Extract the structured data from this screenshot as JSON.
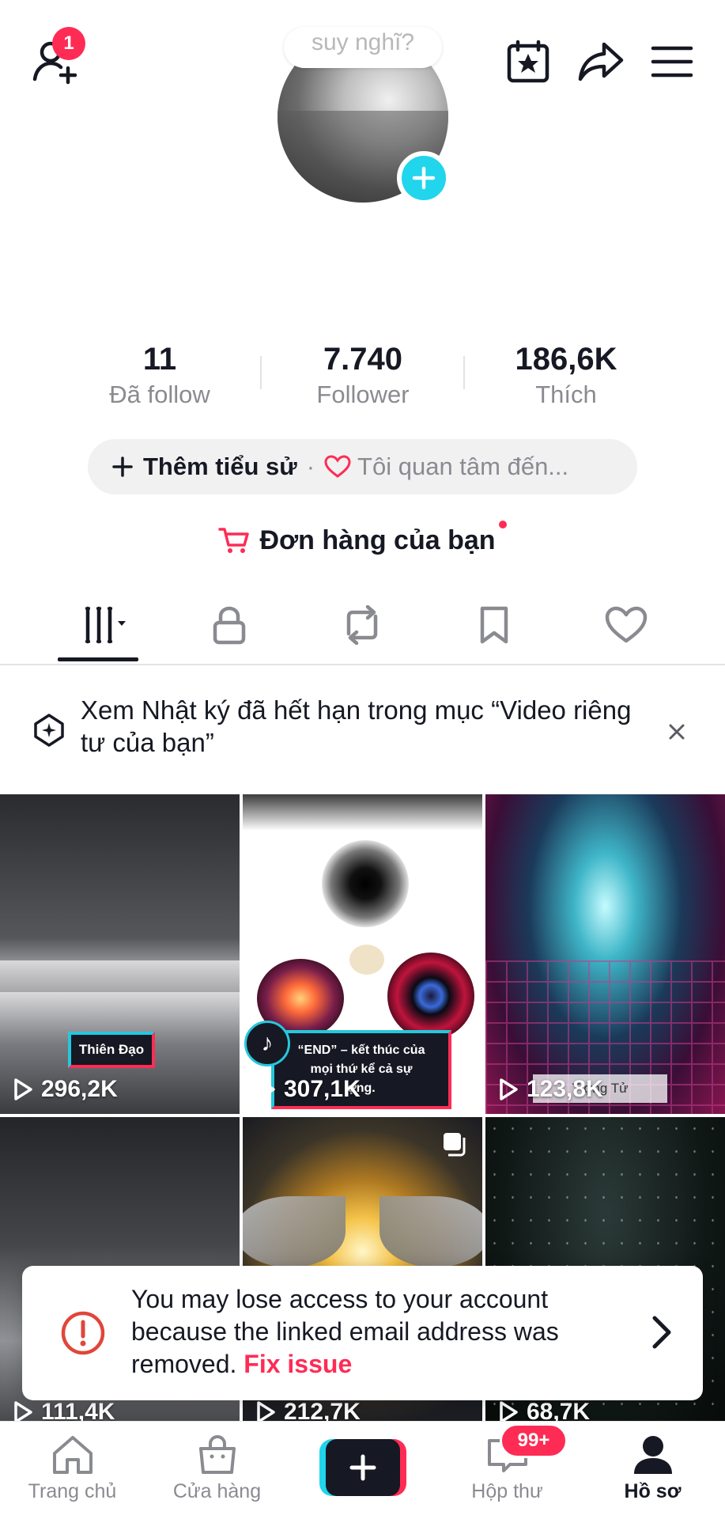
{
  "header": {
    "friend_requests_badge": "1"
  },
  "profile": {
    "avatar_bubble_text": "suy nghĩ?"
  },
  "stats": [
    {
      "value": "11",
      "label": "Đã follow"
    },
    {
      "value": "7.740",
      "label": "Follower"
    },
    {
      "value": "186,6K",
      "label": "Thích"
    }
  ],
  "bio": {
    "add_label": "Thêm tiểu sử",
    "separator": "·",
    "interest_label": "Tôi quan tâm đến..."
  },
  "orders": {
    "label": "Đơn hàng của bạn"
  },
  "tabs": [
    "videos",
    "private",
    "reposts",
    "favorites",
    "liked"
  ],
  "banner": {
    "text": "Xem Nhật ký đã hết hạn trong mục “Video riêng tư của bạn”"
  },
  "videos": [
    {
      "views": "296,2K",
      "overlay": "Thiên Đạo"
    },
    {
      "views": "307,1K",
      "overlay_lines": [
        "“END” – kết thúc của",
        "mọi thứ kể cả sự",
        "ợng."
      ]
    },
    {
      "views": "123,8K",
      "overlay": "T ợng Tử"
    },
    {
      "views": "111,4K"
    },
    {
      "views": "212,7K"
    },
    {
      "views": "68,7K"
    }
  ],
  "toast": {
    "message": "You may lose access to your account because the linked email address was removed.",
    "link": "Fix issue"
  },
  "bottom_nav": [
    {
      "label": "Trang chủ",
      "active": false
    },
    {
      "label": "Cửa hàng",
      "active": false
    },
    {
      "label": "",
      "active": false
    },
    {
      "label": "Hộp thư",
      "active": false,
      "badge": "99+"
    },
    {
      "label": "Hồ sơ",
      "active": true
    }
  ],
  "colors": {
    "accent": "#fe2c55",
    "cyan": "#20d5ec",
    "text_primary": "#161823",
    "text_secondary": "#8a8b91"
  }
}
